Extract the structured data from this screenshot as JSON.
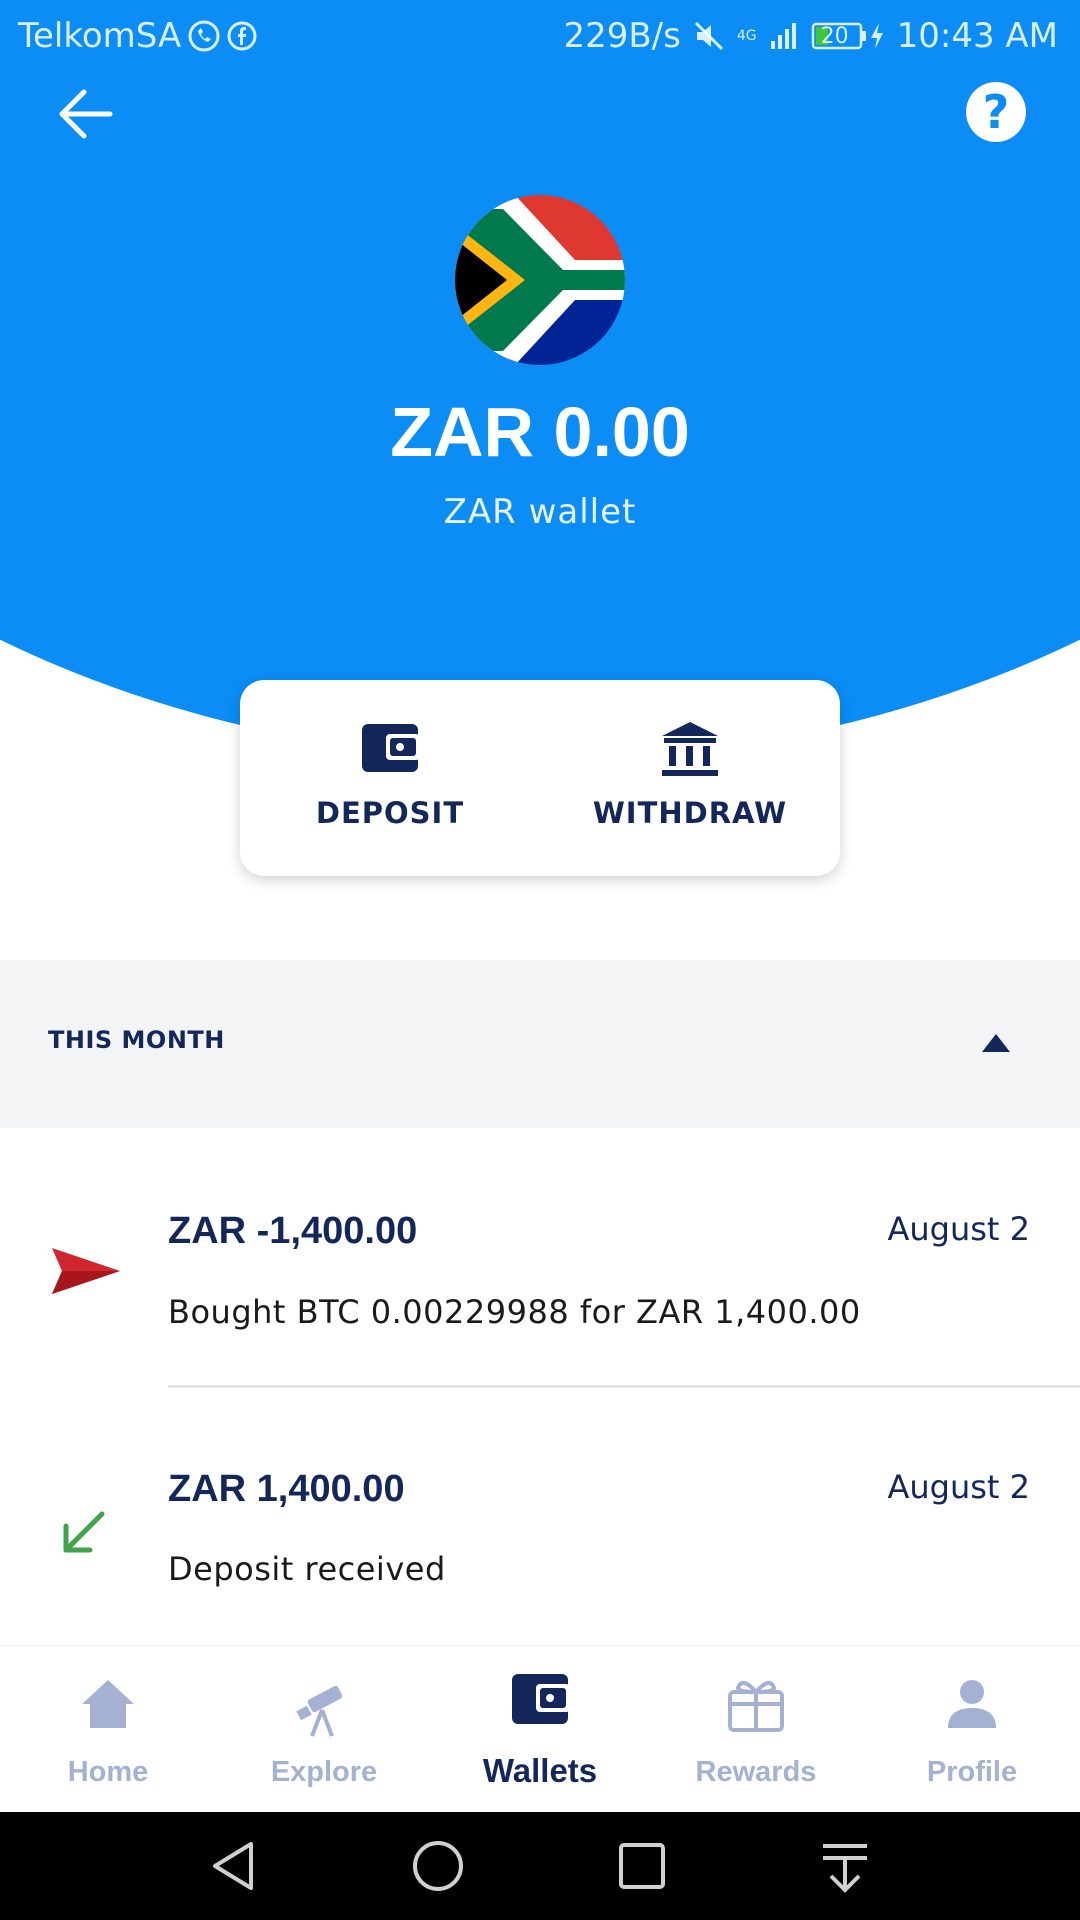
{
  "status_bar": {
    "carrier": "TelkomSA",
    "net_speed": "229B/s",
    "network": "4G",
    "battery": "20",
    "time": "10:43 AM",
    "icons": [
      "whatsapp-icon",
      "facebook-icon",
      "mute-icon",
      "signal-icon",
      "battery-icon",
      "charging-icon"
    ]
  },
  "header": {
    "back_icon": "arrow-left-icon",
    "help_label": "?",
    "flag": "south-africa-flag",
    "balance": "ZAR 0.00",
    "wallet_name": "ZAR wallet"
  },
  "actions": {
    "deposit_label": "DEPOSIT",
    "withdraw_label": "WITHDRAW"
  },
  "section": {
    "label": "THIS MONTH",
    "toggle_icon": "caret-up-icon"
  },
  "transactions": [
    {
      "amount": "ZAR -1,400.00",
      "date": "August 2",
      "description": "Bought BTC 0.00229988 for ZAR 1,400.00",
      "icon": "send-arrow-icon",
      "icon_color": "#d0262e"
    },
    {
      "amount": "ZAR 1,400.00",
      "date": "August 2",
      "description": "Deposit received",
      "icon": "arrow-down-left-icon",
      "icon_color": "#3ea34a"
    }
  ],
  "bottom_nav": [
    {
      "label": "Home",
      "icon": "home-icon",
      "active": false
    },
    {
      "label": "Explore",
      "icon": "telescope-icon",
      "active": false
    },
    {
      "label": "Wallets",
      "icon": "wallet-icon",
      "active": true
    },
    {
      "label": "Rewards",
      "icon": "gift-icon",
      "active": false
    },
    {
      "label": "Profile",
      "icon": "person-icon",
      "active": false
    }
  ],
  "colors": {
    "brand_blue": "#0b8df5",
    "navy": "#14275a",
    "inactive": "#a4b1d3"
  }
}
